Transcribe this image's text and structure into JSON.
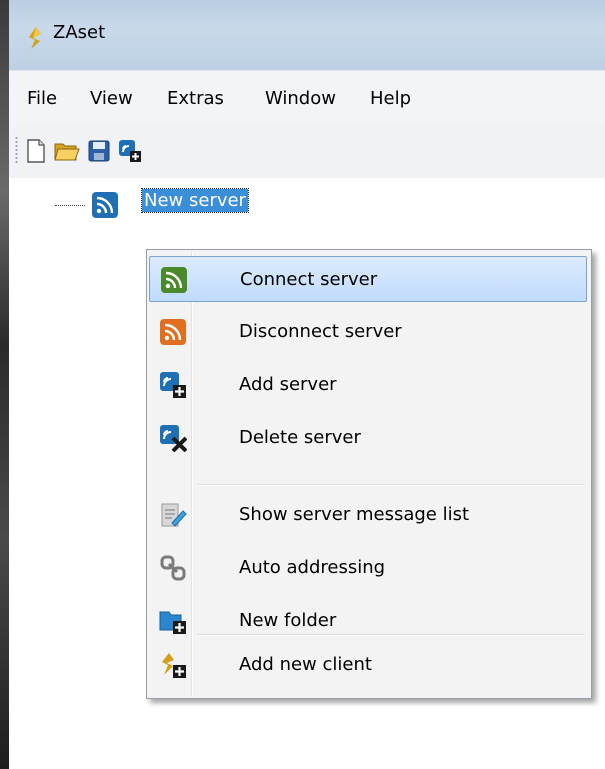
{
  "window": {
    "title": "ZAset"
  },
  "menubar": {
    "items": [
      "File",
      "View",
      "Extras",
      "Window",
      "Help"
    ]
  },
  "toolbar": {
    "buttons": [
      "new-file-icon",
      "open-folder-icon",
      "save-icon",
      "add-server-icon"
    ]
  },
  "tree": {
    "root_label": "New server"
  },
  "context_menu": {
    "items": [
      {
        "label": "Connect server",
        "icon": "connect-server-icon",
        "highlighted": true
      },
      {
        "label": "Disconnect server",
        "icon": "disconnect-server-icon"
      },
      {
        "label": "Add server",
        "icon": "add-server-icon"
      },
      {
        "label": "Delete server",
        "icon": "delete-server-icon"
      },
      {
        "label": "Show server message list",
        "icon": "message-list-icon"
      },
      {
        "label": "Auto addressing",
        "icon": "auto-addressing-icon"
      },
      {
        "label": "New folder",
        "icon": "new-folder-icon"
      },
      {
        "label": "Add new client",
        "icon": "add-client-icon"
      }
    ]
  },
  "colors": {
    "selection": "#3b8ed8",
    "menu_highlight": "#c1dbfc",
    "connect_green": "#4a8a2a",
    "disconnect_orange": "#e07020",
    "server_blue": "#1f6fb5"
  }
}
